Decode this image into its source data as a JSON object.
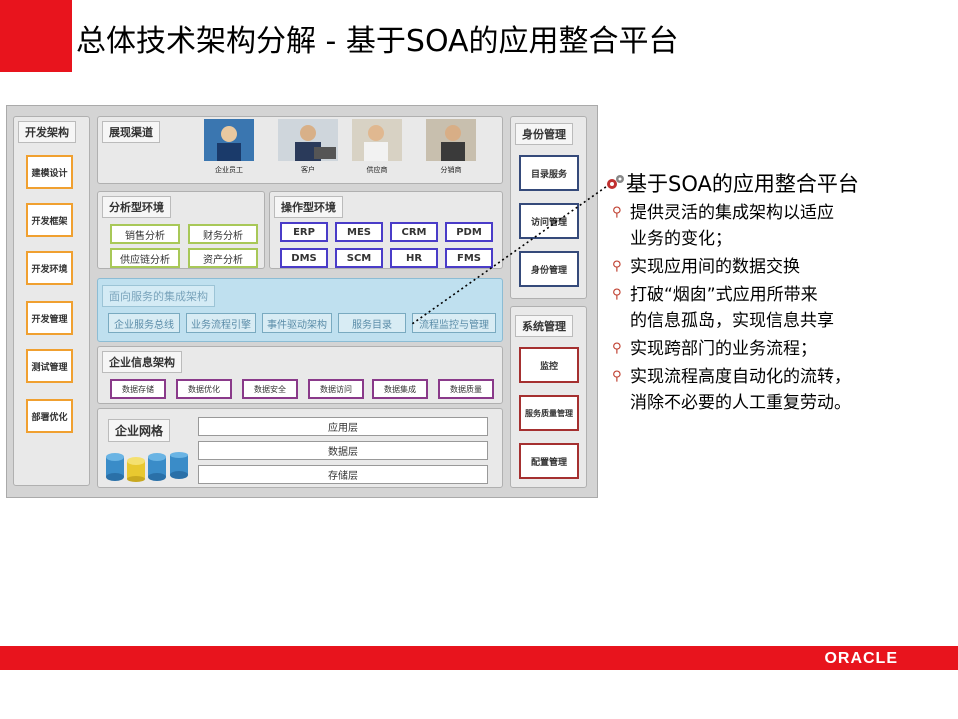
{
  "slide_title": "总体技术架构分解 - 基于SOA的应用整合平台",
  "dev_arch": {
    "title": "开发架构",
    "items": [
      "建模设计",
      "开发框架",
      "开发环境",
      "开发管理",
      "测试管理",
      "部署优化"
    ]
  },
  "channel": {
    "title": "展现渠道",
    "captions": [
      "企业员工",
      "客户",
      "供应商",
      "分销商"
    ]
  },
  "analysis": {
    "title": "分析型环境",
    "items": [
      "销售分析",
      "财务分析",
      "供应链分析",
      "资产分析"
    ]
  },
  "operation": {
    "title": "操作型环境",
    "items": [
      "ERP",
      "MES",
      "CRM",
      "PDM",
      "DMS",
      "SCM",
      "HR",
      "FMS"
    ]
  },
  "soa": {
    "title": "面向服务的集成架构",
    "items": [
      "企业服务总线",
      "业务流程引擎",
      "事件驱动架构",
      "服务目录",
      "流程监控与管理"
    ]
  },
  "info_arch": {
    "title": "企业信息架构",
    "items": [
      "数据存储",
      "数据优化",
      "数据安全",
      "数据访问",
      "数据集成",
      "数据质量"
    ]
  },
  "grid": {
    "title": "企业网格",
    "layers": [
      "应用层",
      "数据层",
      "存储层"
    ]
  },
  "identity": {
    "title": "身份管理",
    "items": [
      "目录服务",
      "访问管理",
      "身份管理"
    ]
  },
  "system": {
    "title": "系统管理",
    "items": [
      "监控",
      "服务质量管理",
      "配置管理"
    ]
  },
  "bullets": {
    "heading": "基于SOA的应用整合平台",
    "items": [
      [
        "提供灵活的集成架构以适应",
        "业务的变化；"
      ],
      [
        "实现应用间的数据交换"
      ],
      [
        "打破“烟囱”式应用所带来",
        "的信息孤岛，实现信息共享"
      ],
      [
        "实现跨部门的业务流程；"
      ],
      [
        "实现流程高度自动化的流转，",
        "消除不必要的人工重复劳动。"
      ]
    ]
  },
  "logo": "ORACLE",
  "icons": [
    "gear-icon",
    "magnifier-bullet-icon",
    "database-cylinder-icon"
  ],
  "colors": {
    "brand_red": "#e8141d",
    "dev_border": "#f0a030",
    "analysis_border": "#a8c858",
    "operation_border": "#4a3cc8",
    "info_border": "#8a3a8a",
    "system_border": "#a53030",
    "identity_border": "#354a7a",
    "soa_fill": "#d8ecf4"
  }
}
